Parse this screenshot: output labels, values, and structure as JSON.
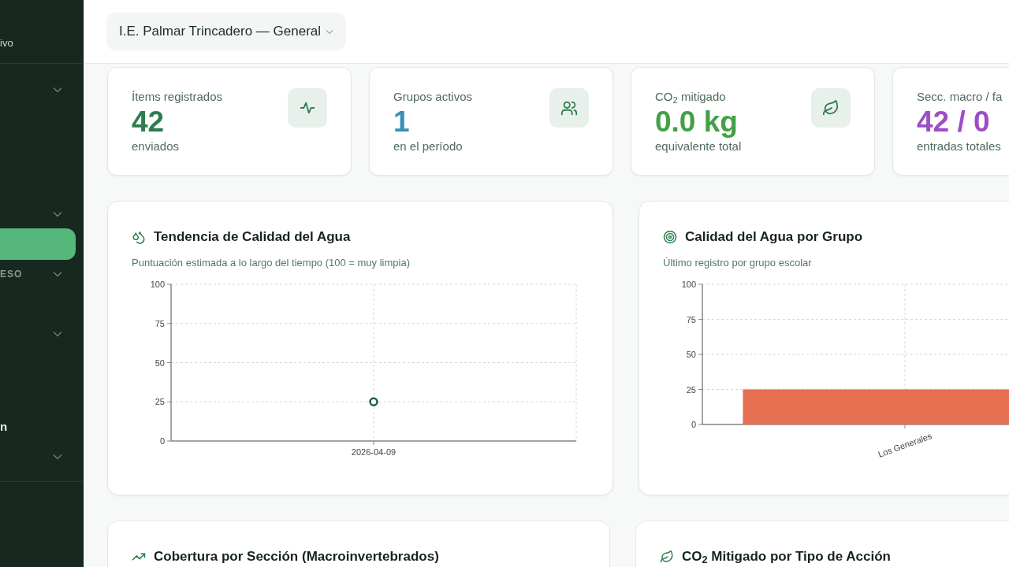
{
  "sidebar": {
    "brand": "ivo",
    "rows": [
      {
        "kind": "group",
        "expanded": false
      },
      {
        "kind": "group",
        "expanded": false
      },
      {
        "kind": "item",
        "selected": true
      },
      {
        "kind": "group",
        "label": "ESO",
        "expanded": false
      },
      {
        "kind": "group",
        "expanded": false
      },
      {
        "kind": "item",
        "label": "n",
        "selected": false
      },
      {
        "kind": "group",
        "expanded": false
      }
    ]
  },
  "header": {
    "school_selector": "I.E. Palmar Trincadero — General"
  },
  "stats": [
    {
      "label": "Ítems registrados",
      "value": "42",
      "caption": "enviados",
      "color": "#2e7d4f"
    },
    {
      "label": "Grupos activos",
      "value": "1",
      "caption": "en el período",
      "color": "#3a8fb7"
    },
    {
      "label": "CO$_{2}$ mitigado",
      "value": "0.0 kg",
      "caption": "equivalente total",
      "color": "#43a047"
    },
    {
      "label": "Secc. macro / fa",
      "value": "42 / 0",
      "caption": "entradas totales",
      "color": "#9c4fc4"
    }
  ],
  "charts": [
    {
      "title": "Tendencia de Calidad del Agua",
      "subtitle": "Puntuación estimada a lo largo del tiempo (100 = muy limpia)",
      "chart_data": {
        "type": "line",
        "grid": true,
        "categories": [
          "2026-04-09"
        ],
        "series": [
          {
            "color": "#1e5e3f",
            "marker": "circle",
            "values": [
              25
            ]
          }
        ],
        "ylim": [
          0,
          100
        ],
        "yticks": [
          0,
          25,
          50,
          75,
          100
        ]
      }
    },
    {
      "title": "Calidad del Agua por Grupo",
      "subtitle": "Último registro por grupo escolar",
      "chart_data": {
        "type": "bar",
        "grid": true,
        "categories": [
          "Los Generales"
        ],
        "series": [
          {
            "color": "#e66f52",
            "values": [
              25
            ]
          }
        ],
        "ylim": [
          0,
          100
        ],
        "yticks": [
          0,
          25,
          50,
          75,
          100
        ]
      }
    }
  ],
  "bottom_cards": [
    {
      "title": "Cobertura por Sección (Macroinvertebrados)"
    },
    {
      "title": "CO$_{2}$ Mitigado por Tipo de Acción"
    }
  ]
}
